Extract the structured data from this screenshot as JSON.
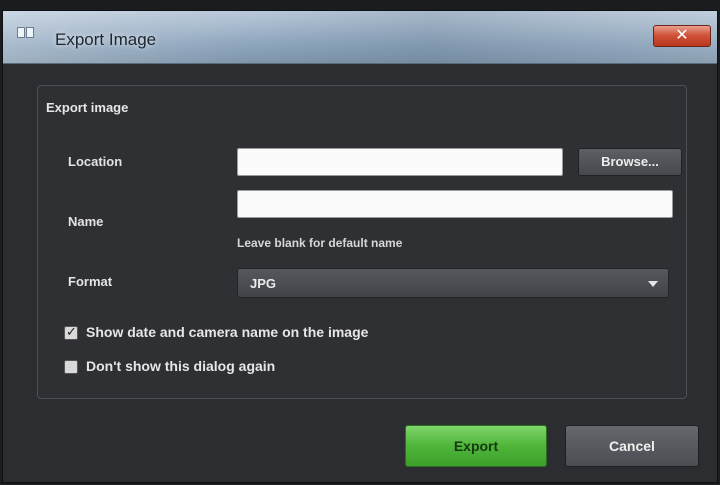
{
  "window": {
    "title": "Export Image",
    "close_symbol": "✕"
  },
  "group": {
    "title": "Export image"
  },
  "location": {
    "label": "Location",
    "value": "",
    "browse_label": "Browse..."
  },
  "name": {
    "label": "Name",
    "value": "",
    "hint": "Leave blank for default name"
  },
  "format": {
    "label": "Format",
    "selected": "JPG"
  },
  "options": {
    "show_date_label": "Show date and camera name on the image",
    "show_date_checked": true,
    "dont_show_label": "Don't show this dialog again",
    "dont_show_checked": false,
    "check_mark": "✓"
  },
  "buttons": {
    "export_label": "Export",
    "cancel_label": "Cancel"
  },
  "icons": [
    "app-icon",
    "close-icon",
    "dropdown-arrow-icon",
    "checkbox-check-icon"
  ],
  "colors": {
    "accent_green": "#4fb63a",
    "dialog_bg": "#2b2d30",
    "close_red": "#d0543b"
  }
}
